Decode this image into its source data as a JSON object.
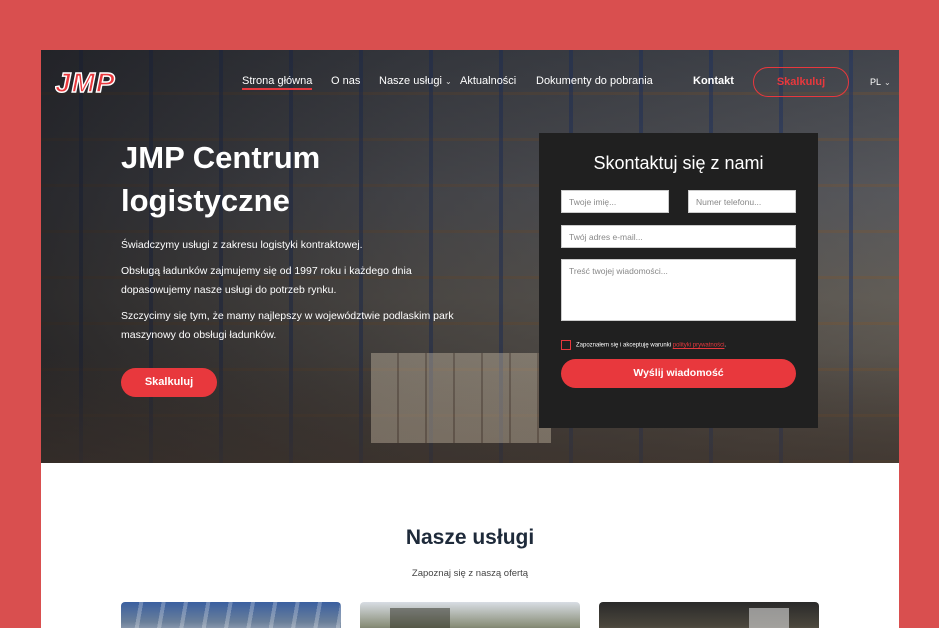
{
  "brand": {
    "logo_text": "JMP",
    "accent": "#e8383d",
    "outer_background": "#d94f4f"
  },
  "nav": {
    "items": [
      {
        "label": "Strona główna",
        "active": true
      },
      {
        "label": "O nas"
      },
      {
        "label": "Nasze usługi",
        "has_dropdown": true
      },
      {
        "label": "Aktualności"
      },
      {
        "label": "Dokumenty do pobrania"
      },
      {
        "label": "Kontakt",
        "bold": true
      }
    ],
    "cta_label": "Skalkuluj",
    "language": "PL"
  },
  "hero": {
    "title": "JMP Centrum logistyczne",
    "paragraphs": [
      "Świadczymy usługi z zakresu logistyki kontraktowej.",
      "Obsługą ładunków zajmujemy się od 1997 roku i każdego dnia dopasowujemy nasze usługi do potrzeb rynku.",
      "Szczycimy się tym, że mamy najlepszy w województwie podlaskim park maszynowy do obsługi ładunków."
    ],
    "button_label": "Skalkuluj"
  },
  "contact_form": {
    "title": "Skontaktuj się z nami",
    "name_placeholder": "Twoje imię...",
    "phone_placeholder": "Numer telefonu...",
    "email_placeholder": "Twój adres e-mail...",
    "message_placeholder": "Treść twojej wiadomości...",
    "consent_text": "Zapoznałem się i akceptuję warunki",
    "consent_link": "polityki prywatności",
    "consent_end": ".",
    "submit_label": "Wyślij wiadomość"
  },
  "services": {
    "title": "Nasze usługi",
    "subtitle": "Zapoznaj się z naszą ofertą"
  }
}
